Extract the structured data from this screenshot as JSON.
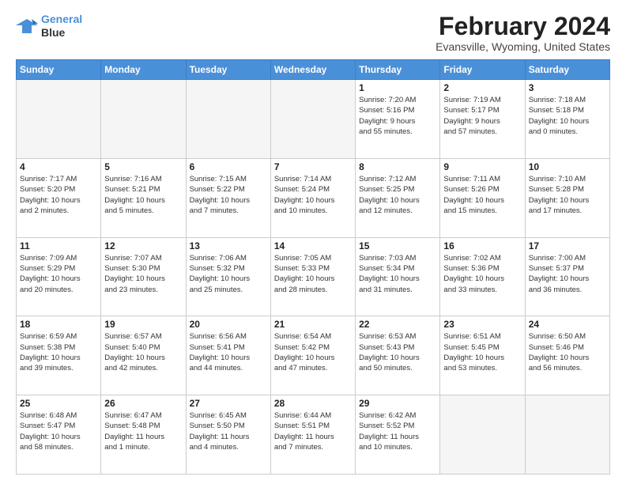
{
  "logo": {
    "line1": "General",
    "line2": "Blue"
  },
  "title": "February 2024",
  "location": "Evansville, Wyoming, United States",
  "days_of_week": [
    "Sunday",
    "Monday",
    "Tuesday",
    "Wednesday",
    "Thursday",
    "Friday",
    "Saturday"
  ],
  "weeks": [
    [
      {
        "day": "",
        "info": ""
      },
      {
        "day": "",
        "info": ""
      },
      {
        "day": "",
        "info": ""
      },
      {
        "day": "",
        "info": ""
      },
      {
        "day": "1",
        "info": "Sunrise: 7:20 AM\nSunset: 5:16 PM\nDaylight: 9 hours\nand 55 minutes."
      },
      {
        "day": "2",
        "info": "Sunrise: 7:19 AM\nSunset: 5:17 PM\nDaylight: 9 hours\nand 57 minutes."
      },
      {
        "day": "3",
        "info": "Sunrise: 7:18 AM\nSunset: 5:18 PM\nDaylight: 10 hours\nand 0 minutes."
      }
    ],
    [
      {
        "day": "4",
        "info": "Sunrise: 7:17 AM\nSunset: 5:20 PM\nDaylight: 10 hours\nand 2 minutes."
      },
      {
        "day": "5",
        "info": "Sunrise: 7:16 AM\nSunset: 5:21 PM\nDaylight: 10 hours\nand 5 minutes."
      },
      {
        "day": "6",
        "info": "Sunrise: 7:15 AM\nSunset: 5:22 PM\nDaylight: 10 hours\nand 7 minutes."
      },
      {
        "day": "7",
        "info": "Sunrise: 7:14 AM\nSunset: 5:24 PM\nDaylight: 10 hours\nand 10 minutes."
      },
      {
        "day": "8",
        "info": "Sunrise: 7:12 AM\nSunset: 5:25 PM\nDaylight: 10 hours\nand 12 minutes."
      },
      {
        "day": "9",
        "info": "Sunrise: 7:11 AM\nSunset: 5:26 PM\nDaylight: 10 hours\nand 15 minutes."
      },
      {
        "day": "10",
        "info": "Sunrise: 7:10 AM\nSunset: 5:28 PM\nDaylight: 10 hours\nand 17 minutes."
      }
    ],
    [
      {
        "day": "11",
        "info": "Sunrise: 7:09 AM\nSunset: 5:29 PM\nDaylight: 10 hours\nand 20 minutes."
      },
      {
        "day": "12",
        "info": "Sunrise: 7:07 AM\nSunset: 5:30 PM\nDaylight: 10 hours\nand 23 minutes."
      },
      {
        "day": "13",
        "info": "Sunrise: 7:06 AM\nSunset: 5:32 PM\nDaylight: 10 hours\nand 25 minutes."
      },
      {
        "day": "14",
        "info": "Sunrise: 7:05 AM\nSunset: 5:33 PM\nDaylight: 10 hours\nand 28 minutes."
      },
      {
        "day": "15",
        "info": "Sunrise: 7:03 AM\nSunset: 5:34 PM\nDaylight: 10 hours\nand 31 minutes."
      },
      {
        "day": "16",
        "info": "Sunrise: 7:02 AM\nSunset: 5:36 PM\nDaylight: 10 hours\nand 33 minutes."
      },
      {
        "day": "17",
        "info": "Sunrise: 7:00 AM\nSunset: 5:37 PM\nDaylight: 10 hours\nand 36 minutes."
      }
    ],
    [
      {
        "day": "18",
        "info": "Sunrise: 6:59 AM\nSunset: 5:38 PM\nDaylight: 10 hours\nand 39 minutes."
      },
      {
        "day": "19",
        "info": "Sunrise: 6:57 AM\nSunset: 5:40 PM\nDaylight: 10 hours\nand 42 minutes."
      },
      {
        "day": "20",
        "info": "Sunrise: 6:56 AM\nSunset: 5:41 PM\nDaylight: 10 hours\nand 44 minutes."
      },
      {
        "day": "21",
        "info": "Sunrise: 6:54 AM\nSunset: 5:42 PM\nDaylight: 10 hours\nand 47 minutes."
      },
      {
        "day": "22",
        "info": "Sunrise: 6:53 AM\nSunset: 5:43 PM\nDaylight: 10 hours\nand 50 minutes."
      },
      {
        "day": "23",
        "info": "Sunrise: 6:51 AM\nSunset: 5:45 PM\nDaylight: 10 hours\nand 53 minutes."
      },
      {
        "day": "24",
        "info": "Sunrise: 6:50 AM\nSunset: 5:46 PM\nDaylight: 10 hours\nand 56 minutes."
      }
    ],
    [
      {
        "day": "25",
        "info": "Sunrise: 6:48 AM\nSunset: 5:47 PM\nDaylight: 10 hours\nand 58 minutes."
      },
      {
        "day": "26",
        "info": "Sunrise: 6:47 AM\nSunset: 5:48 PM\nDaylight: 11 hours\nand 1 minute."
      },
      {
        "day": "27",
        "info": "Sunrise: 6:45 AM\nSunset: 5:50 PM\nDaylight: 11 hours\nand 4 minutes."
      },
      {
        "day": "28",
        "info": "Sunrise: 6:44 AM\nSunset: 5:51 PM\nDaylight: 11 hours\nand 7 minutes."
      },
      {
        "day": "29",
        "info": "Sunrise: 6:42 AM\nSunset: 5:52 PM\nDaylight: 11 hours\nand 10 minutes."
      },
      {
        "day": "",
        "info": ""
      },
      {
        "day": "",
        "info": ""
      }
    ]
  ]
}
